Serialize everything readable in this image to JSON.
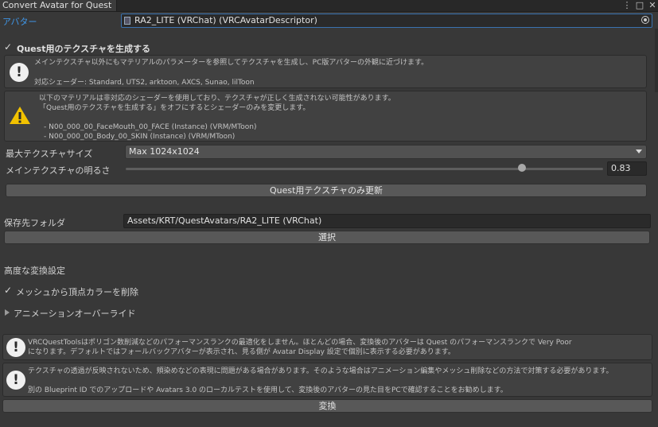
{
  "window": {
    "tab_title": "Convert Avatar for Quest",
    "menu_icon": "⋮",
    "maximize_icon": "□",
    "close_icon": "✕"
  },
  "avatar": {
    "label": "アバター",
    "value": "RA2_LITE (VRChat) (VRCAvatarDescriptor)"
  },
  "quest_texture": {
    "checkbox_label": "Quest用のテクスチャを生成する",
    "checked": true,
    "info_line1": "メインテクスチャ以外にもマテリアルのパラメーターを参照してテクスチャを生成し、PC版アバターの外観に近づけます。",
    "info_line2": "対応シェーダー: Standard, UTS2, arktoon, AXCS, Sunao, lilToon",
    "warn_line1": "以下のマテリアルは非対応のシェーダーを使用しており、テクスチャが正しく生成されない可能性があります。",
    "warn_line2": "「Quest用のテクスチャを生成する」をオフにするとシェーダーのみを変更します。",
    "warn_line3": "- N00_000_00_FaceMouth_00_FACE (Instance) (VRM/MToon)",
    "warn_line4": "- N00_000_00_Body_00_SKIN (Instance) (VRM/MToon)",
    "max_size_label": "最大テクスチャサイズ",
    "max_size_value": "Max 1024x1024",
    "brightness_label": "メインテクスチャの明るさ",
    "brightness_value": "0.83",
    "brightness_fraction": 0.83,
    "update_button": "Quest用テクスチャのみ更新"
  },
  "output": {
    "label": "保存先フォルダ",
    "value": "Assets/KRT/QuestAvatars/RA2_LITE (VRChat)",
    "select_button": "選択"
  },
  "advanced": {
    "heading": "高度な変換設定",
    "remove_vertex_color_label": "メッシュから頂点カラーを削除",
    "remove_vertex_color_checked": true,
    "animation_override_label": "アニメーションオーバーライド"
  },
  "notes": {
    "note1_line1": "VRCQuestToolsはポリゴン数削減などのパフォーマンスランクの最適化をしません。ほとんどの場合、変換後のアバターは Quest のパフォーマンスランクで Very Poor",
    "note1_line2": "になります。デフォルトではフォールバックアバターが表示され、見る側が Avatar Display 設定で個別に表示する必要があります。",
    "note2_line1": "テクスチャの透過が反映されないため、頬染めなどの表現に問題がある場合があります。そのような場合はアニメーション編集やメッシュ削除などの方法で対策する必要があります。",
    "note2_line2": "別の Blueprint ID でのアップロードや Avatars 3.0 のローカルテストを使用して、変換後のアバターの見た目をPCで確認することをお勧めします。"
  },
  "convert_button": "変換"
}
